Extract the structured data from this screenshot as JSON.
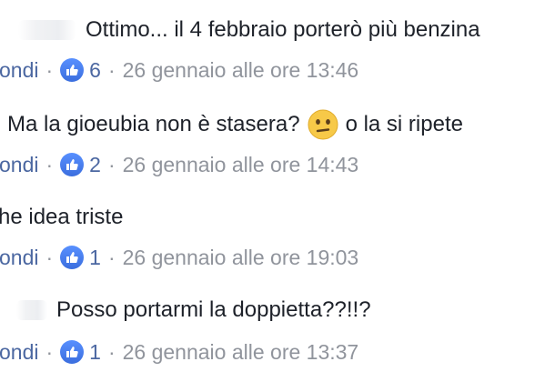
{
  "comments": [
    {
      "text": "Ottimo... il 4 febbraio porterò più benzina",
      "reply_label": "ondi",
      "like_count": "6",
      "timestamp": "26 gennaio alle ore 13:46"
    },
    {
      "text": "Ma la gioeubia non è stasera?",
      "text_after_emoji": "o la si ripete",
      "emoji": "confused-face-emoji",
      "reply_label": "ondi",
      "like_count": "2",
      "timestamp": "26 gennaio alle ore 14:43"
    },
    {
      "text": "he idea triste",
      "reply_label": "ondi",
      "like_count": "1",
      "timestamp": "26 gennaio alle ore 19:03"
    },
    {
      "text": "Posso portarmi la doppietta??!!?",
      "reply_label": "ondi",
      "like_count": "1",
      "timestamp": "26 gennaio alle ore 13:37"
    }
  ],
  "separator": "·",
  "icons": {
    "like": "like-thumb-icon"
  },
  "colors": {
    "text": "#1d2129",
    "meta": "#90949c",
    "link": "#4b67a1",
    "like_badge": "#3b6ede",
    "emoji_yellow": "#f7c948"
  }
}
